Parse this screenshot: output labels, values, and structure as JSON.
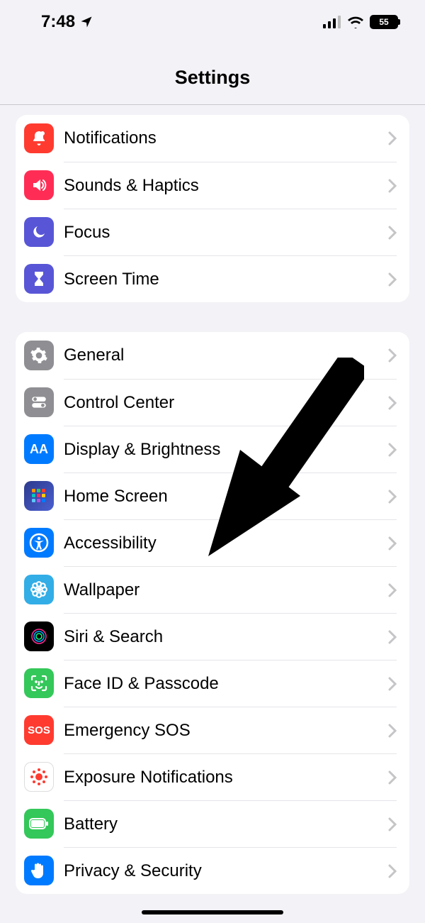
{
  "status": {
    "time": "7:48",
    "location_icon": "location-arrow",
    "battery_pct": "55"
  },
  "header": {
    "title": "Settings"
  },
  "group1": [
    {
      "key": "notifications",
      "label": "Notifications",
      "icon": "bell",
      "bg": "bg-red"
    },
    {
      "key": "sounds",
      "label": "Sounds & Haptics",
      "icon": "speaker",
      "bg": "bg-pink-red"
    },
    {
      "key": "focus",
      "label": "Focus",
      "icon": "moon",
      "bg": "bg-indigo"
    },
    {
      "key": "screentime",
      "label": "Screen Time",
      "icon": "hourglass",
      "bg": "bg-indigo"
    }
  ],
  "group2": [
    {
      "key": "general",
      "label": "General",
      "icon": "gear",
      "bg": "bg-gray"
    },
    {
      "key": "controlcenter",
      "label": "Control Center",
      "icon": "toggles",
      "bg": "bg-gray"
    },
    {
      "key": "display",
      "label": "Display & Brightness",
      "icon": "AA",
      "bg": "bg-blue"
    },
    {
      "key": "homescreen",
      "label": "Home Screen",
      "icon": "grid",
      "bg": "bg-blue"
    },
    {
      "key": "accessibility",
      "label": "Accessibility",
      "icon": "person-circle",
      "bg": "bg-blue"
    },
    {
      "key": "wallpaper",
      "label": "Wallpaper",
      "icon": "flower",
      "bg": "bg-cyan"
    },
    {
      "key": "siri",
      "label": "Siri & Search",
      "icon": "siri",
      "bg": "bg-black"
    },
    {
      "key": "faceid",
      "label": "Face ID & Passcode",
      "icon": "face",
      "bg": "bg-green"
    },
    {
      "key": "sos",
      "label": "Emergency SOS",
      "icon": "SOS",
      "bg": "bg-red"
    },
    {
      "key": "exposure",
      "label": "Exposure Notifications",
      "icon": "covid",
      "bg": "bg-white-b"
    },
    {
      "key": "battery",
      "label": "Battery",
      "icon": "battery",
      "bg": "bg-green"
    },
    {
      "key": "privacy",
      "label": "Privacy & Security",
      "icon": "hand",
      "bg": "bg-blue"
    }
  ],
  "annotation": {
    "points_to": "accessibility"
  }
}
